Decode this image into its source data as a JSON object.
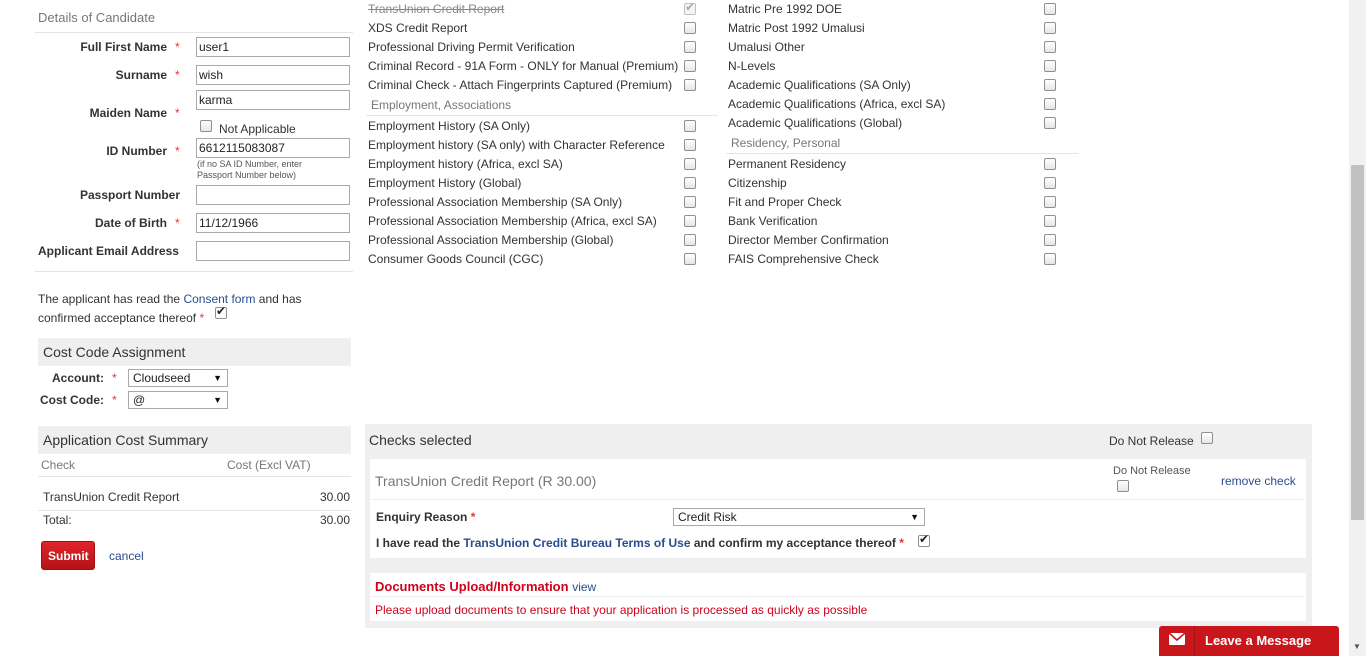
{
  "candidate": {
    "title": "Details of Candidate",
    "full_first_name_label": "Full First Name",
    "full_first_name_value": "user1",
    "surname_label": "Surname",
    "surname_value": "wish",
    "maiden_name_label": "Maiden Name",
    "maiden_name_value": "karma",
    "not_applicable_label": "Not Applicable",
    "id_number_label": "ID Number",
    "id_number_value": "6612115083087",
    "id_note_line1": "(if no SA ID Number, enter",
    "id_note_line2": "Passport Number below)",
    "passport_label": "Passport Number",
    "passport_value": "",
    "dob_label": "Date of Birth",
    "dob_value": "11/12/1966",
    "email_label": "Applicant Email Address",
    "email_value": "",
    "required_mark": "*",
    "consent_text1": "The applicant has read the ",
    "consent_link": "Consent form",
    "consent_text2": " and has",
    "consent_text3": "confirmed acceptance thereof"
  },
  "cost_code": {
    "title": "Cost Code Assignment",
    "account_label": "Account:",
    "account_value": "Cloudseed",
    "cost_code_label": "Cost Code:",
    "cost_code_value": "@"
  },
  "cost_summary": {
    "title": "Application Cost Summary",
    "col_check": "Check",
    "col_cost": "Cost (Excl VAT)",
    "rows": [
      {
        "check": "TransUnion Credit Report",
        "cost": "30.00"
      }
    ],
    "total_label": "Total:",
    "total_value": "30.00",
    "submit_label": "Submit",
    "cancel_label": "cancel"
  },
  "checks_col1": {
    "items_top": [
      {
        "label": "TransUnion Credit Report",
        "state": "checked-disabled"
      },
      {
        "label": "XDS Credit Report",
        "state": "unchecked"
      },
      {
        "label": "Professional Driving Permit Verification",
        "state": "unchecked"
      },
      {
        "label": "Criminal Record - 91A Form - ONLY for Manual (Premium)",
        "state": "unchecked"
      },
      {
        "label": "Criminal Check - Attach Fingerprints Captured (Premium)",
        "state": "unchecked"
      }
    ],
    "section_employment": "Employment, Associations",
    "items_employment": [
      {
        "label": "Employment History (SA Only)"
      },
      {
        "label": "Employment history (SA only) with Character Reference"
      },
      {
        "label": "Employment history (Africa, excl SA)"
      },
      {
        "label": "Employment History (Global)"
      },
      {
        "label": "Professional Association Membership (SA Only)"
      },
      {
        "label": "Professional Association Membership (Africa, excl SA)"
      },
      {
        "label": "Professional Association Membership (Global)"
      },
      {
        "label": "Consumer Goods Council (CGC)"
      }
    ]
  },
  "checks_col2": {
    "items_top": [
      {
        "label": "Matric Pre 1992 DOE"
      },
      {
        "label": "Matric Post 1992 Umalusi"
      },
      {
        "label": "Umalusi Other"
      },
      {
        "label": "N-Levels"
      },
      {
        "label": "Academic Qualifications (SA Only)"
      },
      {
        "label": "Academic Qualifications (Africa, excl SA)"
      },
      {
        "label": "Academic Qualifications (Global)"
      }
    ],
    "section_residency": "Residency, Personal",
    "items_residency": [
      {
        "label": "Permanent Residency"
      },
      {
        "label": "Citizenship"
      },
      {
        "label": "Fit and Proper Check"
      },
      {
        "label": "Bank Verification"
      },
      {
        "label": "Director Member Confirmation"
      },
      {
        "label": "FAIS Comprehensive Check"
      }
    ]
  },
  "checks_selected": {
    "title": "Checks selected",
    "do_not_release_label": "Do Not Release",
    "item_title": "TransUnion Credit Report (R 30.00)",
    "item_do_not_release": "Do Not Release",
    "remove_label": "remove check",
    "enquiry_label": "Enquiry Reason",
    "enquiry_value": "Credit Risk",
    "terms_text1": "I have read the ",
    "terms_link": "TransUnion Credit Bureau Terms of Use",
    "terms_text2": " and confirm my acceptance thereof"
  },
  "documents": {
    "title": "Documents Upload/Information",
    "view_label": "view",
    "message": "Please upload documents to ensure that your application is processed as quickly as possible"
  },
  "chat": {
    "label": "Leave a Message",
    "icon": "envelope-icon"
  },
  "colors": {
    "accent_red": "#c9161b",
    "link_blue": "#2a4d8f",
    "panel_grey": "#efefef"
  }
}
